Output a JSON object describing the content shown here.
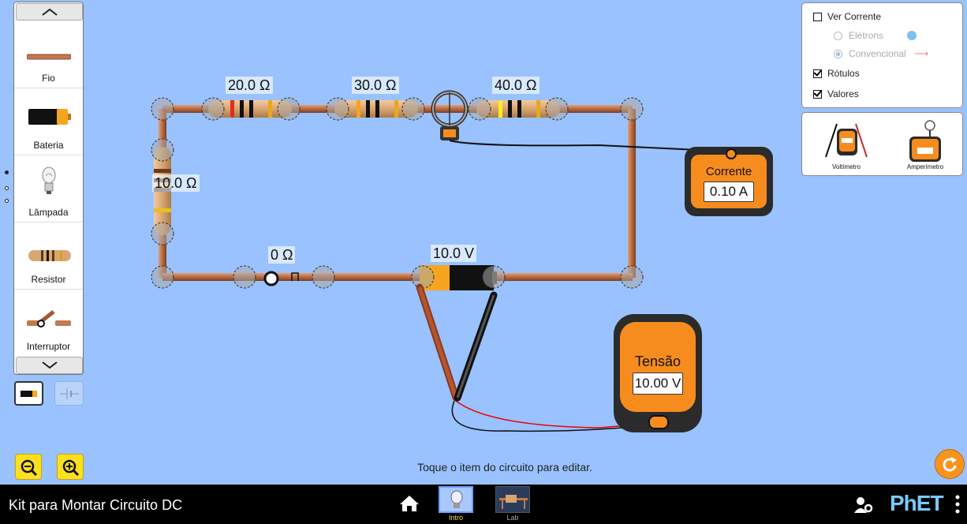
{
  "toolbox": {
    "items": [
      {
        "label": "Fio",
        "icon": "wire-icon"
      },
      {
        "label": "Bateria",
        "icon": "battery-icon"
      },
      {
        "label": "Lâmpada",
        "icon": "light-bulb-icon"
      },
      {
        "label": "Resistor",
        "icon": "resistor-icon"
      },
      {
        "label": "Interruptor",
        "icon": "switch-icon"
      }
    ]
  },
  "circuit": {
    "labels": {
      "r1": "20.0 Ω",
      "r2": "30.0 Ω",
      "r3": "40.0 Ω",
      "r4": "10.0 Ω",
      "switch": "0 Ω",
      "battery": "10.0 V"
    }
  },
  "view_panel": {
    "show_current": "Ver Corrente",
    "electrons": "Elétrons",
    "conventional": "Convencional",
    "labels": "Rótulos",
    "values": "Valores",
    "show_current_checked": false,
    "labels_checked": true,
    "values_checked": true
  },
  "sensor_panel": {
    "voltmeter": "Voltímetro",
    "ammeter": "Amperímetro"
  },
  "ammeter": {
    "title": "Corrente",
    "reading": "0.10 A"
  },
  "voltmeter": {
    "title": "Tensão",
    "reading": "10.00 V"
  },
  "hint": "Toque o item do circuito para editar.",
  "navbar": {
    "title": "Kit para Montar Circuito DC",
    "tabs": [
      {
        "label": "Intro",
        "selected": true
      },
      {
        "label": "Lab",
        "selected": false
      }
    ],
    "brand": "PhET"
  },
  "colors": {
    "background": "#99c2fe",
    "wire": "#c07a4e",
    "meter_orange": "#f78c1e",
    "zoom_yellow": "#fbe020"
  }
}
